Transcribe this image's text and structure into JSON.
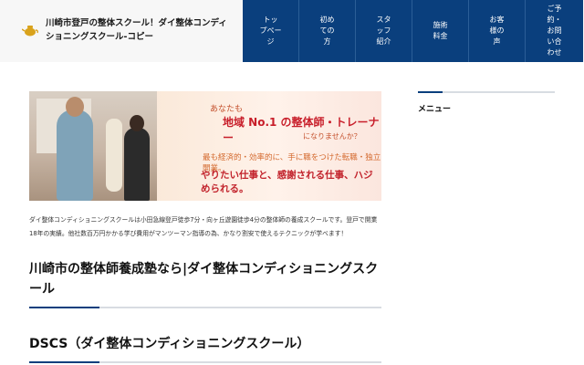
{
  "header": {
    "site_title": "川崎市登戸の整体スクール！ダイ整体コンディショニングスクール-コピー",
    "logo_icon": "teapot-logo-icon"
  },
  "nav": {
    "items": [
      {
        "label": "トッ\nプペー\nジ"
      },
      {
        "label": "初め\nての\n方"
      },
      {
        "label": "スタ\nッフ\n紹介"
      },
      {
        "label": "施術\n料金"
      },
      {
        "label": "お客\n様の\n声"
      },
      {
        "label": "ご予\n約・\nお問\nい合\nわせ"
      }
    ]
  },
  "hero": {
    "line1": "あなたも",
    "line2": "地域 No.1 の整体師・トレーナー",
    "line3": "になりませんか？",
    "line4": "最も経済的・効率的に、手に職をつけた転職・独立開業。",
    "line5": "やりたい仕事と、感謝される仕事、ハジめられる。"
  },
  "main": {
    "intro": "ダイ整体コンディショニングスクールは小田急線登戸徒歩7分・向ヶ丘遊園徒歩4分の整体師の養成スクールです。登戸で開業18年の実績。他社数百万円かかる学び費用がマンツーマン指導の為、かなり割安で使えるテクニックが学べます！",
    "heading1": "川崎市の整体師養成塾なら|ダイ整体コンディショニングスクール",
    "heading2": "DSCS（ダイ整体コンディショニングスクール）"
  },
  "sidebar": {
    "title": "メニュー"
  },
  "colors": {
    "nav_bg": "#0a3f7d",
    "accent": "#0a3f7d"
  }
}
